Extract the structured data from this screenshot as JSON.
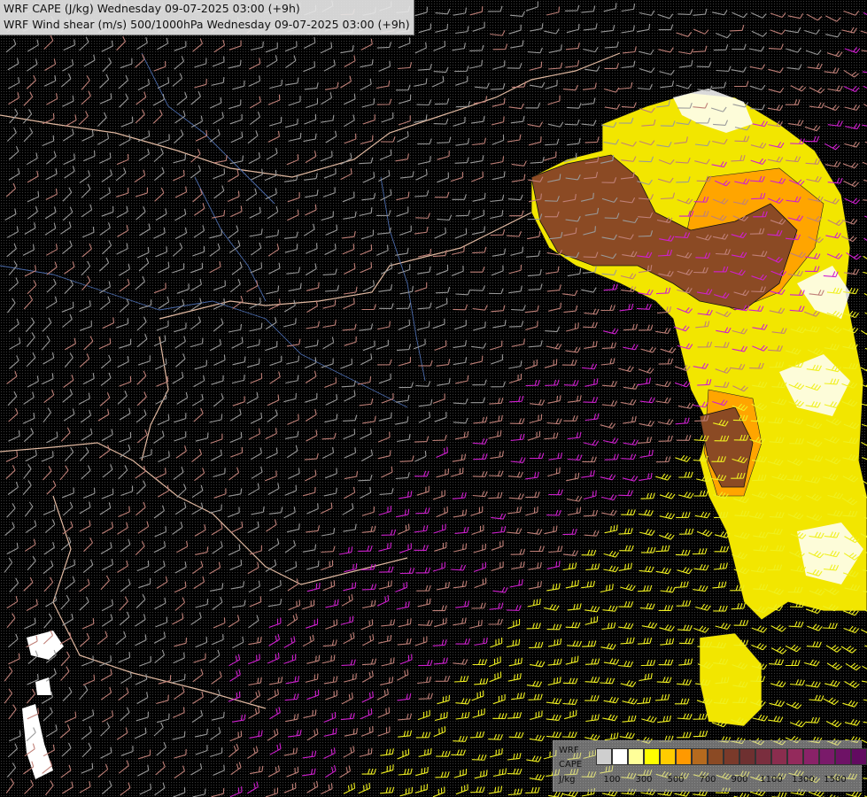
{
  "title": {
    "line1": "WRF CAPE (J/kg) Wednesday 09-07-2025 03:00 (+9h)",
    "line2": "WRF Wind shear (m/s) 500/1000hPa Wednesday 09-07-2025 03:00 (+9h)"
  },
  "legend": {
    "label_line1": "WRF",
    "label_line2": "CAPE",
    "label_line3": "J/kg",
    "colors": [
      "#cfcfcf",
      "#ffffff",
      "#ffff99",
      "#ffff00",
      "#ffcc00",
      "#ff9900",
      "#b56a1e",
      "#8b4a24",
      "#7a3a2a",
      "#6e3030",
      "#7a2e3e",
      "#8a2d4e",
      "#942a5c",
      "#8a2268",
      "#7a1a6a",
      "#6e1266",
      "#620a60"
    ],
    "ticks": [
      "100",
      "300",
      "500",
      "700",
      "900",
      "1100",
      "1300",
      "1500"
    ]
  },
  "colors": {
    "background": "#000000",
    "border_line": "#e0b8a0",
    "river": "#4a6aaa",
    "barb_weak": "#9a9a9a",
    "barb_mid": "#c08078",
    "barb_strong_magenta": "#d020d0",
    "barb_strong_yellow": "#f0f020",
    "cape_brown": "#8b4a24",
    "cape_yellow": "#f2e600",
    "cape_orange": "#ffa500"
  }
}
